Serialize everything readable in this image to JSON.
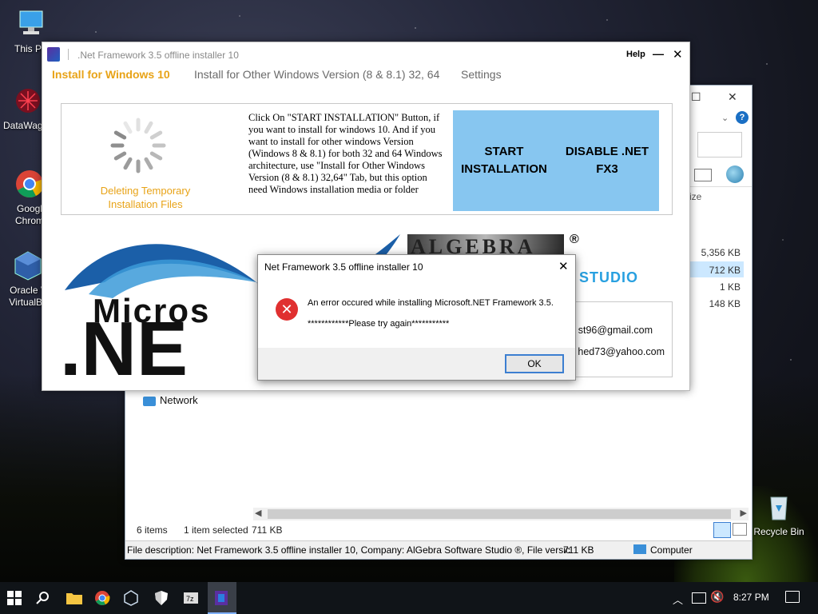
{
  "desktop": {
    "icons": [
      {
        "label": "This PC"
      },
      {
        "label": "DataWag"
      },
      {
        "label": "Googl Chrom"
      },
      {
        "label": "Oracle V VirtualBo"
      },
      {
        "label": "Recycle Bin"
      }
    ]
  },
  "explorer": {
    "size_header": "ize",
    "sizes": [
      "5,356 KB",
      "712 KB",
      "1 KB",
      "148 KB"
    ],
    "nav_network": "Network",
    "items_count": "6 items",
    "selected": "1 item selected",
    "selected_size": "711 KB",
    "info_description": "File description: Net Framework 3.5 offline installer 10, Company: AlGebra Software Studio ®, File versic",
    "info_size": "711 KB",
    "info_location": "Computer"
  },
  "app": {
    "title": ".Net Framework 3.5 offline installer 10",
    "help_label": "Help",
    "minimize_glyph": "—",
    "close_glyph": "✕",
    "tabs": [
      {
        "label": "Install for Windows 10",
        "active": true
      },
      {
        "label": "Install for Other Windows Version (8 & 8.1) 32, 64",
        "active": false
      },
      {
        "label": "Settings",
        "active": false
      }
    ],
    "status_text": "Deleting Temporary Installation Files",
    "instructions": "Click On \"START INSTALLATION\" Button, if you want to install for windows 10. And if you want to install for other windows Version (Windows 8 & 8.1) for both 32 and 64 Windows architecture, use \"Install for Other Windows Version (8 & 8.1) 32,64\" Tab, but this option need Windows installation media or folder",
    "start_button": "START INSTALLATION",
    "disable_button": "DISABLE .NET FX3",
    "net_logo_top": "Micros",
    "net_logo_bottom": ".NE",
    "algebra_logo": "ALGEBRA",
    "registered": "®",
    "studio": "STUDIO",
    "email_1": "st96@gmail.com",
    "email_2": "hed73@yahoo.com"
  },
  "dialog": {
    "title": "Net Framework 3.5 offline installer 10",
    "message_line1": "An error occured while installing Microsoft.NET Framework 3.5.",
    "message_line2": "************Please try again***********",
    "ok_label": "OK",
    "close_glyph": "✕"
  },
  "taskbar": {
    "time": "8:27 PM"
  },
  "colors": {
    "active_tab": "#e8a317",
    "blue_box": "#87c6f0",
    "error_red": "#e03030",
    "taskbar": "#101418"
  }
}
